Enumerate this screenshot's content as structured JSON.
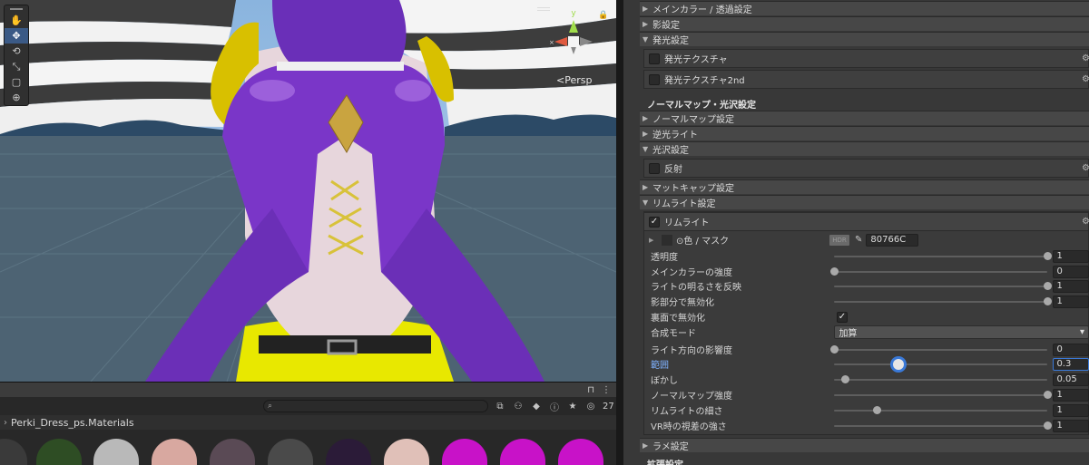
{
  "scene": {
    "persp_label": "<Persp",
    "gizmo_axis_label": "y",
    "tools": [
      "hand-tool",
      "move-tool",
      "rotate-tool",
      "scale-tool",
      "rect-tool",
      "transform-tool"
    ],
    "active_tool": "move-tool",
    "tool_glyphs": [
      "✋",
      "✥",
      "⟲",
      "⤡",
      "▢",
      "⊕"
    ]
  },
  "project": {
    "hidden_count": "27",
    "breadcrumb": "Perki_Dress_ps.Materials",
    "search_placeholder": "",
    "thumb_colors": [
      "#3a3a3a",
      "#2e4d24",
      "#b9b9b9",
      "#d8a8a0",
      "#5a4a55",
      "#4a4a4a",
      "#2b1b38",
      "#e0c0b8",
      "#c812c8",
      "#c812c8",
      "#c812c8"
    ]
  },
  "inspector": {
    "foldouts_top": [
      {
        "label": "メインカラー / 透過設定"
      },
      {
        "label": "影設定"
      },
      {
        "label": "発光設定",
        "expanded": true
      }
    ],
    "emission_boxes": [
      {
        "label": "発光テクスチャ",
        "checked": false
      },
      {
        "label": "発光テクスチャ2nd",
        "checked": false
      }
    ],
    "section_title": "ノーマルマップ・光沢設定",
    "foldouts_mid": [
      {
        "label": "ノーマルマップ設定"
      },
      {
        "label": "逆光ライト"
      },
      {
        "label": "光沢設定",
        "expanded": true
      }
    ],
    "reflection_box": {
      "label": "反射",
      "checked": false
    },
    "foldouts_low": [
      {
        "label": "マットキャップ設定"
      },
      {
        "label": "リムライト設定",
        "expanded": true
      }
    ],
    "rim": {
      "toggle_label": "リムライト",
      "checked": true,
      "color_label": "色 / マスク",
      "hdr_badge": "HDR",
      "color_hex": "80766C",
      "color_value": "#80766C",
      "props": [
        {
          "label": "透明度",
          "value": "1",
          "fraction": 1.0,
          "type": "slider"
        },
        {
          "label": "メインカラーの強度",
          "value": "0",
          "fraction": 0.0,
          "type": "slider"
        },
        {
          "label": "ライトの明るさを反映",
          "value": "1",
          "fraction": 1.0,
          "type": "slider"
        },
        {
          "label": "影部分で無効化",
          "value": "1",
          "fraction": 1.0,
          "type": "slider"
        },
        {
          "label": "裏面で無効化",
          "checked": true,
          "type": "toggle"
        },
        {
          "label": "合成モード",
          "value": "加算",
          "type": "dropdown"
        },
        {
          "label": "ライト方向の影響度",
          "value": "0",
          "fraction": 0.0,
          "type": "slider"
        },
        {
          "label": "範囲",
          "value": "0.3",
          "fraction": 0.3,
          "type": "slider",
          "focused": true
        },
        {
          "label": "ぼかし",
          "value": "0.05",
          "fraction": 0.05,
          "type": "slider"
        },
        {
          "label": "ノーマルマップ強度",
          "value": "1",
          "fraction": 1.0,
          "type": "slider"
        },
        {
          "label": "リムライトの細さ",
          "value": "1",
          "fraction": 0.2,
          "type": "slider"
        },
        {
          "label": "VR時の視差の強さ",
          "value": "1",
          "fraction": 1.0,
          "type": "slider"
        }
      ]
    },
    "foldout_bottom": {
      "label": "ラメ設定"
    },
    "cut_title": "拡張設定"
  }
}
